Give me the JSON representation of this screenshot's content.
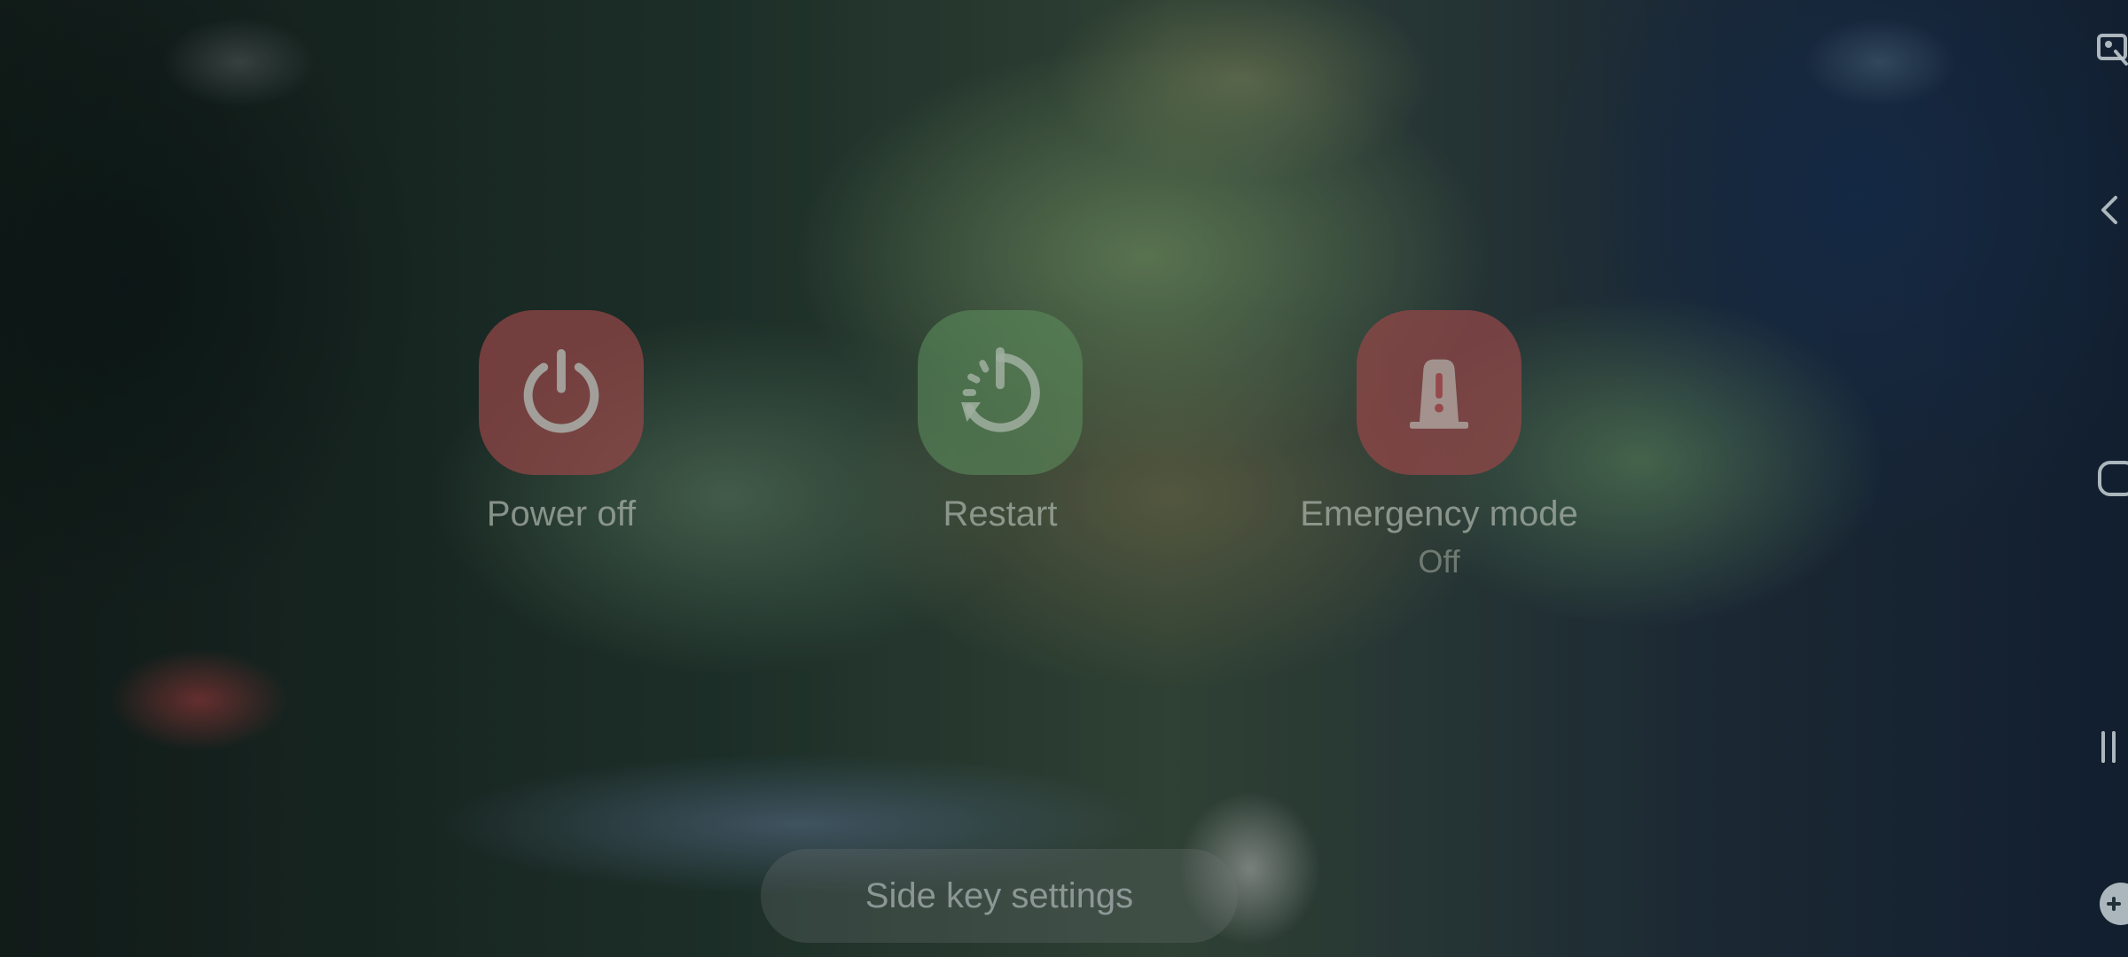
{
  "power_menu": {
    "power_off": {
      "label": "Power off",
      "icon": "power-icon",
      "color": "#96464a"
    },
    "restart": {
      "label": "Restart",
      "icon": "restart-icon",
      "color": "#5c8c5c"
    },
    "emergency_mode": {
      "label": "Emergency mode",
      "status": "Off",
      "icon": "siren-icon",
      "color": "#96464a"
    }
  },
  "side_key_settings": {
    "label": "Side key settings"
  },
  "edge_panel": {
    "items": [
      {
        "icon": "screenshot-edit-icon"
      },
      {
        "icon": "back-chevron-icon"
      },
      {
        "icon": "home-icon"
      },
      {
        "icon": "recents-icon"
      },
      {
        "icon": "game-controller-icon"
      }
    ]
  }
}
